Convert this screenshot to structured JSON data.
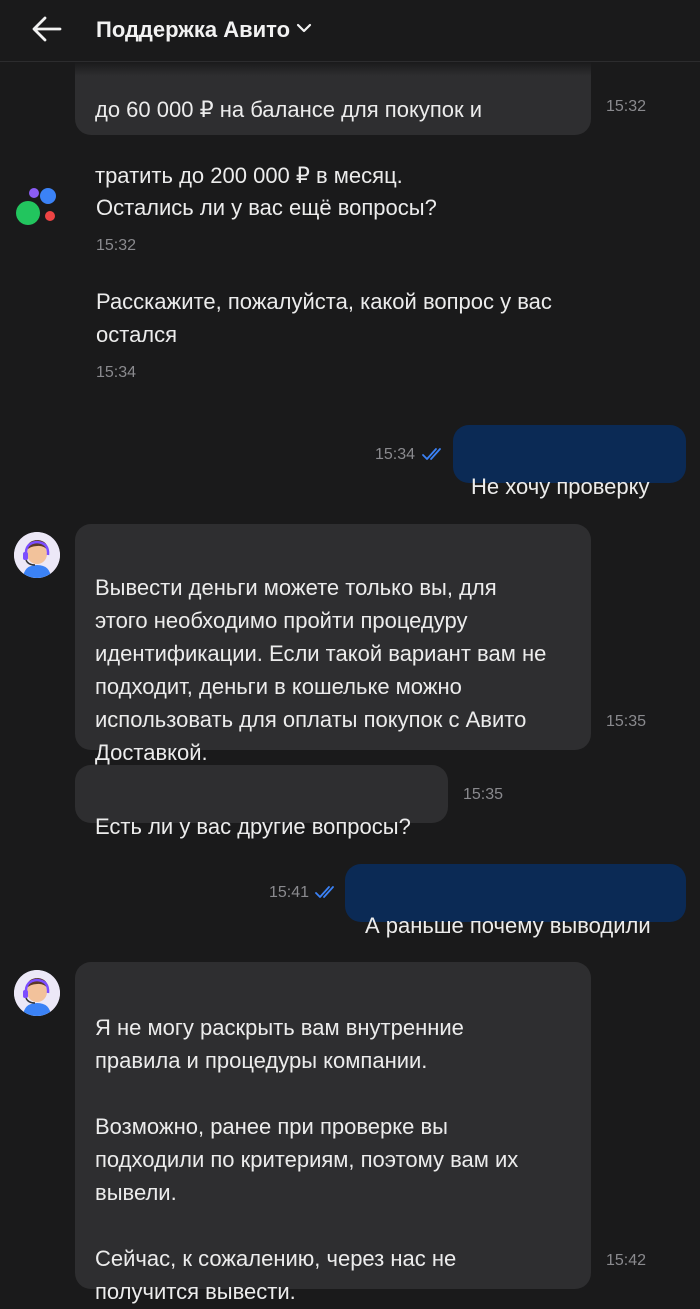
{
  "header": {
    "title": "Поддержка Авито"
  },
  "messages": {
    "m1": {
      "line1": "до 60 000 ₽ на балансе для покупок и",
      "line2": "тратить до 200 000 ₽ в месяц.",
      "time": "15:32"
    },
    "m2": {
      "text": "Остались ли у вас ещё вопросы?",
      "time": "15:32"
    },
    "m3": {
      "text": "Расскажите, пожалуйста, какой вопрос у вас\nостался",
      "time": "15:34"
    },
    "m4": {
      "text": "Не хочу проверку",
      "time": "15:34"
    },
    "m5": {
      "text": "Вывести деньги можете только вы, для\nэтого необходимо пройти процедуру\nидентификации. Если такой вариант вам не\nподходит, деньги в кошельке можно\nиспользовать для оплаты покупок с Авито\nДоставкой.",
      "time": "15:35"
    },
    "m6": {
      "text": "Есть ли у вас другие вопросы?",
      "time": "15:35"
    },
    "m7": {
      "text": "А раньше почему выводили",
      "time": "15:41"
    },
    "m8": {
      "text": "Я не могу раскрыть вам внутренние\nправила и процедуры компании.\n\nВозможно, ранее при проверке вы\nподходили по критериям, поэтому вам их\nвывели.\n\nСейчас, к сожалению, через нас не\nполучится вывести.",
      "time": "15:42"
    }
  },
  "colors": {
    "background": "#1a1a1b",
    "incoming_bubble": "#2e2e30",
    "outgoing_bubble": "#0b2a55",
    "read_check": "#3b82f6",
    "avito_dots": [
      "#8b5cf6",
      "#3b82f6",
      "#22c55e",
      "#ef4444"
    ]
  },
  "icons": {
    "back": "arrow-left-icon",
    "title_dropdown": "chevron-down-icon",
    "read_status": "double-check-icon",
    "bot_avatar": "avito-logo-icon",
    "agent_avatar": "support-agent-avatar"
  }
}
